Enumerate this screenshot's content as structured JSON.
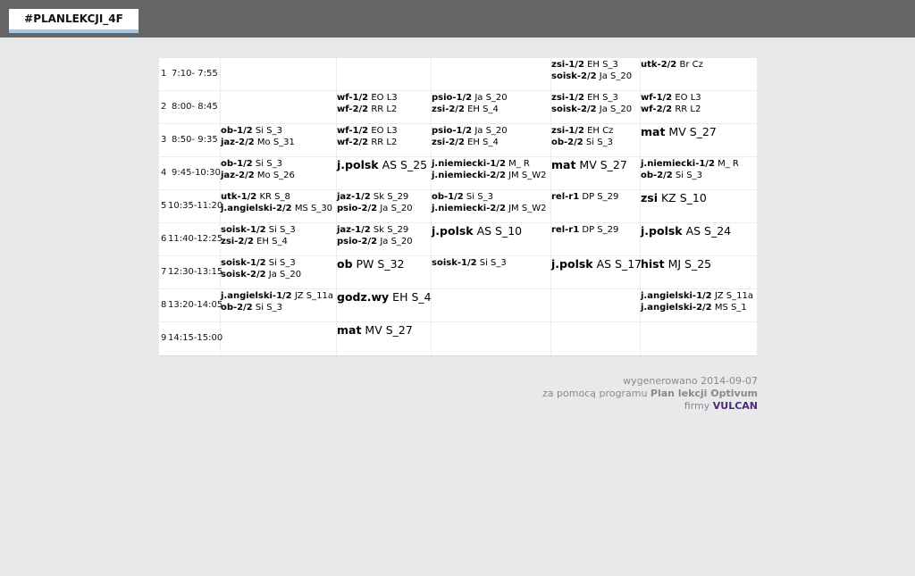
{
  "header": {
    "title": "#PLANLEKCJI_4F"
  },
  "rows": [
    {
      "num": "1",
      "time": "7:10- 7:55"
    },
    {
      "num": "2",
      "time": "8:00- 8:45"
    },
    {
      "num": "3",
      "time": "8:50- 9:35"
    },
    {
      "num": "4",
      "time": "9:45-10:30"
    },
    {
      "num": "5",
      "time": "10:35-11:20"
    },
    {
      "num": "6",
      "time": "11:40-12:25"
    },
    {
      "num": "7",
      "time": "12:30-13:15"
    },
    {
      "num": "8",
      "time": "13:20-14:05"
    },
    {
      "num": "9",
      "time": "14:15-15:00"
    }
  ],
  "cells": [
    {
      "r": 0,
      "c": 3,
      "lines": [
        {
          "s": "zsi-1/2",
          "d": " EH S_3"
        },
        {
          "s": "soisk-2/2",
          "d": " Ja S_20"
        }
      ]
    },
    {
      "r": 0,
      "c": 4,
      "lines": [
        {
          "s": "utk-2/2",
          "d": " Br Cz"
        }
      ]
    },
    {
      "r": 1,
      "c": 1,
      "lines": [
        {
          "s": "wf-1/2",
          "d": " EO L3"
        },
        {
          "s": "wf-2/2",
          "d": " RR L2"
        }
      ]
    },
    {
      "r": 1,
      "c": 2,
      "lines": [
        {
          "s": "psio-1/2",
          "d": " Ja S_20"
        },
        {
          "s": "zsi-2/2",
          "d": " EH S_4"
        }
      ]
    },
    {
      "r": 1,
      "c": 3,
      "lines": [
        {
          "s": "zsi-1/2",
          "d": " EH S_3"
        },
        {
          "s": "soisk-2/2",
          "d": " Ja S_20"
        }
      ]
    },
    {
      "r": 1,
      "c": 4,
      "lines": [
        {
          "s": "wf-1/2",
          "d": " EO L3"
        },
        {
          "s": "wf-2/2",
          "d": " RR L2"
        }
      ]
    },
    {
      "r": 2,
      "c": 0,
      "lines": [
        {
          "s": "ob-1/2",
          "d": " Si S_3"
        },
        {
          "s": "jaz-2/2",
          "d": " Mo S_31"
        }
      ]
    },
    {
      "r": 2,
      "c": 1,
      "lines": [
        {
          "s": "wf-1/2",
          "d": " EO L3"
        },
        {
          "s": "wf-2/2",
          "d": " RR L2"
        }
      ]
    },
    {
      "r": 2,
      "c": 2,
      "lines": [
        {
          "s": "psio-1/2",
          "d": " Ja S_20"
        },
        {
          "s": "zsi-2/2",
          "d": " EH S_4"
        }
      ]
    },
    {
      "r": 2,
      "c": 3,
      "lines": [
        {
          "s": "zsi-1/2",
          "d": " EH Cz"
        },
        {
          "s": "ob-2/2",
          "d": " Si S_3"
        }
      ]
    },
    {
      "r": 2,
      "c": 4,
      "big": true,
      "lines": [
        {
          "s": "mat",
          "d": " MV S_27"
        }
      ]
    },
    {
      "r": 3,
      "c": 0,
      "lines": [
        {
          "s": "ob-1/2",
          "d": " Si S_3"
        },
        {
          "s": "jaz-2/2",
          "d": " Mo S_26"
        }
      ]
    },
    {
      "r": 3,
      "c": 1,
      "big": true,
      "lines": [
        {
          "s": "j.polsk",
          "d": " AS S_25"
        }
      ]
    },
    {
      "r": 3,
      "c": 2,
      "lines": [
        {
          "s": "j.niemiecki-1/2",
          "d": " M_ R"
        },
        {
          "s": "j.niemiecki-2/2",
          "d": " JM S_W2"
        }
      ]
    },
    {
      "r": 3,
      "c": 3,
      "big": true,
      "lines": [
        {
          "s": "mat",
          "d": " MV S_27"
        }
      ]
    },
    {
      "r": 3,
      "c": 4,
      "lines": [
        {
          "s": "j.niemiecki-1/2",
          "d": " M_ R"
        },
        {
          "s": "ob-2/2",
          "d": " Si S_3"
        }
      ]
    },
    {
      "r": 4,
      "c": 0,
      "lines": [
        {
          "s": "utk-1/2",
          "d": " KR S_8"
        },
        {
          "s": "j.angielski-2/2",
          "d": " MS S_30"
        }
      ]
    },
    {
      "r": 4,
      "c": 1,
      "lines": [
        {
          "s": "jaz-1/2",
          "d": " Sk S_29"
        },
        {
          "s": "psio-2/2",
          "d": " Ja S_20"
        }
      ]
    },
    {
      "r": 4,
      "c": 2,
      "lines": [
        {
          "s": "ob-1/2",
          "d": " Si S_3"
        },
        {
          "s": "j.niemiecki-2/2",
          "d": " JM S_W2"
        }
      ]
    },
    {
      "r": 4,
      "c": 3,
      "lines": [
        {
          "s": "rel-r1",
          "d": " DP S_29"
        }
      ]
    },
    {
      "r": 4,
      "c": 4,
      "big": true,
      "lines": [
        {
          "s": "zsi",
          "d": " KZ S_10"
        }
      ]
    },
    {
      "r": 5,
      "c": 0,
      "lines": [
        {
          "s": "soisk-1/2",
          "d": " Si S_3"
        },
        {
          "s": "zsi-2/2",
          "d": " EH S_4"
        }
      ]
    },
    {
      "r": 5,
      "c": 1,
      "lines": [
        {
          "s": "jaz-1/2",
          "d": " Sk S_29"
        },
        {
          "s": "psio-2/2",
          "d": " Ja S_20"
        }
      ]
    },
    {
      "r": 5,
      "c": 2,
      "big": true,
      "lines": [
        {
          "s": "j.polsk",
          "d": " AS S_10"
        }
      ]
    },
    {
      "r": 5,
      "c": 3,
      "lines": [
        {
          "s": "rel-r1",
          "d": " DP S_29"
        }
      ]
    },
    {
      "r": 5,
      "c": 4,
      "big": true,
      "lines": [
        {
          "s": "j.polsk",
          "d": " AS S_24"
        }
      ]
    },
    {
      "r": 6,
      "c": 0,
      "lines": [
        {
          "s": "soisk-1/2",
          "d": " Si S_3"
        },
        {
          "s": "soisk-2/2",
          "d": " Ja S_20"
        }
      ]
    },
    {
      "r": 6,
      "c": 1,
      "big": true,
      "lines": [
        {
          "s": "ob",
          "d": " PW S_32"
        }
      ]
    },
    {
      "r": 6,
      "c": 2,
      "lines": [
        {
          "s": "soisk-1/2",
          "d": " Si S_3"
        }
      ]
    },
    {
      "r": 6,
      "c": 3,
      "big": true,
      "lines": [
        {
          "s": "j.polsk",
          "d": " AS S_17"
        }
      ]
    },
    {
      "r": 6,
      "c": 4,
      "big": true,
      "lines": [
        {
          "s": "hist",
          "d": " MJ S_25"
        }
      ]
    },
    {
      "r": 7,
      "c": 0,
      "lines": [
        {
          "s": "j.angielski-1/2",
          "d": " JZ S_11a"
        },
        {
          "s": "ob-2/2",
          "d": " Si S_3"
        }
      ]
    },
    {
      "r": 7,
      "c": 1,
      "big": true,
      "lines": [
        {
          "s": "godz.wy",
          "d": " EH S_4"
        }
      ]
    },
    {
      "r": 7,
      "c": 4,
      "lines": [
        {
          "s": "j.angielski-1/2",
          "d": " JZ S_11a"
        },
        {
          "s": "j.angielski-2/2",
          "d": " MS S_1"
        }
      ]
    },
    {
      "r": 8,
      "c": 1,
      "big": true,
      "lines": [
        {
          "s": "mat",
          "d": " MV S_27"
        }
      ]
    }
  ],
  "footer": {
    "line1": "wygenerowano 2014-09-07",
    "line2_prefix": "za pomocą programu ",
    "line2_product": "Plan lekcji Optivum",
    "line3_prefix": "firmy ",
    "line3_company": "VULCAN"
  },
  "colors": {
    "topbar": "#666666",
    "background": "#e8e9ea",
    "accent": "#a6c8e4",
    "vulcan": "#4b2a7a"
  }
}
